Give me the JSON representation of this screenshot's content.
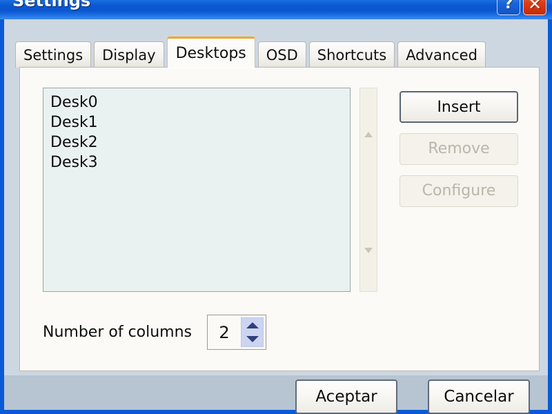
{
  "window": {
    "title": "Settings",
    "caption_buttons": [
      {
        "name": "help",
        "glyph": "?"
      },
      {
        "name": "close",
        "glyph": "✕"
      }
    ]
  },
  "tabs": [
    {
      "label": "Settings",
      "active": false
    },
    {
      "label": "Display",
      "active": false
    },
    {
      "label": "Desktops",
      "active": true
    },
    {
      "label": "OSD",
      "active": false
    },
    {
      "label": "Shortcuts",
      "active": false
    },
    {
      "label": "Advanced",
      "active": false
    }
  ],
  "desktops_panel": {
    "list": {
      "items": [
        "Desk0",
        "Desk1",
        "Desk2",
        "Desk3"
      ],
      "selected": null
    },
    "scrollbar": {
      "up_arrow": "▲",
      "down_arrow": "▼"
    },
    "actions": [
      {
        "label": "Insert",
        "enabled": true
      },
      {
        "label": "Remove",
        "enabled": false
      },
      {
        "label": "Configure",
        "enabled": false
      }
    ],
    "columns": {
      "label": "Number of columns",
      "value": "2"
    }
  },
  "footer": {
    "buttons": [
      {
        "label": "Aceptar"
      },
      {
        "label": "Cancelar"
      }
    ]
  },
  "colors": {
    "title_bar_blue": "#0a58d2",
    "window_border": "#0a5ad8",
    "active_tab_accent": "#f5a623",
    "listbox_background": "#eaf2f1",
    "panel_background": "#fbfaf7",
    "footer_background": "#b7c4d2",
    "spinner_arrows": "#ccd4ef",
    "close_button_red": "#de3b14"
  }
}
